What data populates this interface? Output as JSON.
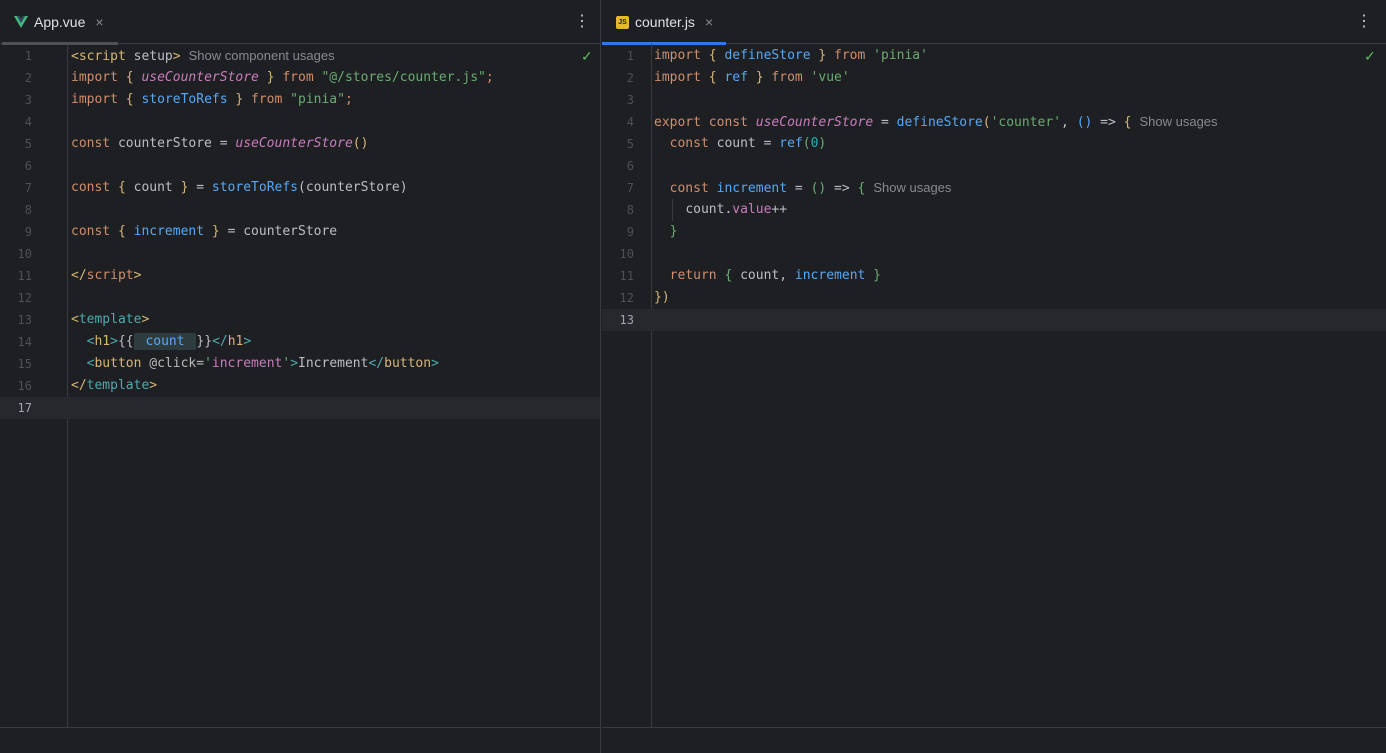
{
  "left": {
    "tab": {
      "label": "App.vue",
      "icon": "vue-icon",
      "close": "×"
    },
    "more": "⋮",
    "check": "✓",
    "lines": [
      {
        "n": "1"
      },
      {
        "n": "2"
      },
      {
        "n": "3"
      },
      {
        "n": "4"
      },
      {
        "n": "5"
      },
      {
        "n": "6"
      },
      {
        "n": "7"
      },
      {
        "n": "8"
      },
      {
        "n": "9"
      },
      {
        "n": "10"
      },
      {
        "n": "11"
      },
      {
        "n": "12"
      },
      {
        "n": "13"
      },
      {
        "n": "14"
      },
      {
        "n": "15"
      },
      {
        "n": "16"
      },
      {
        "n": "17"
      }
    ],
    "tokens": {
      "l1a": "<script",
      "l1b": " setup",
      "l1c": ">",
      "l1hint": "Show component usages",
      "l2a": "import",
      "l2b": " { ",
      "l2c": "useCounterStore",
      "l2d": " } ",
      "l2e": "from",
      "l2f": " \"@/stores/counter.js\"",
      "l2g": ";",
      "l3a": "import",
      "l3b": " { ",
      "l3c": "storeToRefs",
      "l3d": " } ",
      "l3e": "from",
      "l3f": " \"pinia\"",
      "l3g": ";",
      "l5a": "const",
      "l5b": " counterStore = ",
      "l5c": "useCounterStore",
      "l5d": "()",
      "l7a": "const",
      "l7b": " { ",
      "l7c": "count",
      "l7d": " } ",
      "l7e": "= ",
      "l7f": "storeToRefs",
      "l7g": "(counterStore)",
      "l9a": "const",
      "l9b": " { ",
      "l9c": "increment",
      "l9d": " } ",
      "l9e": "= counterStore",
      "l11a": "</",
      "l11b": "script",
      "l11c": ">",
      "l13a": "<",
      "l13b": "template",
      "l13c": ">",
      "l14pre": "  ",
      "l14a": "<",
      "l14b": "h1",
      "l14c": ">",
      "l14d": "{{",
      "l14e": " count ",
      "l14f": "}}",
      "l14g": "</",
      "l14h": "h1",
      "l14i": ">",
      "l15pre": "  ",
      "l15a": "<",
      "l15b": "button",
      "l15c": " @click=",
      "l15d": "'",
      "l15e": "increment",
      "l15f": "'",
      "l15g": ">",
      "l15h": "Increment",
      "l15i": "</",
      "l15j": "button",
      "l15k": ">",
      "l16a": "</",
      "l16b": "template",
      "l16c": ">"
    }
  },
  "right": {
    "tab": {
      "label": "counter.js",
      "icon": "js-file-icon",
      "icon_text": "JS",
      "close": "×"
    },
    "more": "⋮",
    "check": "✓",
    "lines": [
      {
        "n": "1"
      },
      {
        "n": "2"
      },
      {
        "n": "3"
      },
      {
        "n": "4"
      },
      {
        "n": "5"
      },
      {
        "n": "6"
      },
      {
        "n": "7"
      },
      {
        "n": "8"
      },
      {
        "n": "9"
      },
      {
        "n": "10"
      },
      {
        "n": "11"
      },
      {
        "n": "12"
      },
      {
        "n": "13"
      }
    ],
    "tokens": {
      "r1a": "import",
      "r1b": " { ",
      "r1c": "defineStore",
      "r1d": " } ",
      "r1e": "from",
      "r1f": " 'pinia'",
      "r2a": "import",
      "r2b": " { ",
      "r2c": "ref",
      "r2d": " } ",
      "r2e": "from",
      "r2f": " 'vue'",
      "r4a": "export",
      "r4b": " const ",
      "r4c": "useCounterStore",
      "r4d": " = ",
      "r4e": "defineStore",
      "r4f": "(",
      "r4g": "'counter'",
      "r4h": ", ",
      "r4i": "()",
      "r4j": " => ",
      "r4k": "{",
      "r4hint": "Show usages",
      "r5pre": "  ",
      "r5a": "const",
      "r5b": " count = ",
      "r5c": "ref",
      "r5d": "(",
      "r5e": "0",
      "r5f": ")",
      "r7pre": "  ",
      "r7a": "const",
      "r7b": " ",
      "r7c": "increment",
      "r7d": " = ",
      "r7e": "()",
      "r7f": " => ",
      "r7g": "{",
      "r7hint": "Show usages",
      "r8pre": "    ",
      "r8a": "count.",
      "r8b": "value",
      "r8c": "++",
      "r9pre": "  ",
      "r9a": "}",
      "r11pre": "  ",
      "r11a": "return",
      "r11b": " { ",
      "r11c": "count, ",
      "r11d": "increment",
      "r11e": " }",
      "r12a": "}",
      "r12b": ")"
    }
  }
}
